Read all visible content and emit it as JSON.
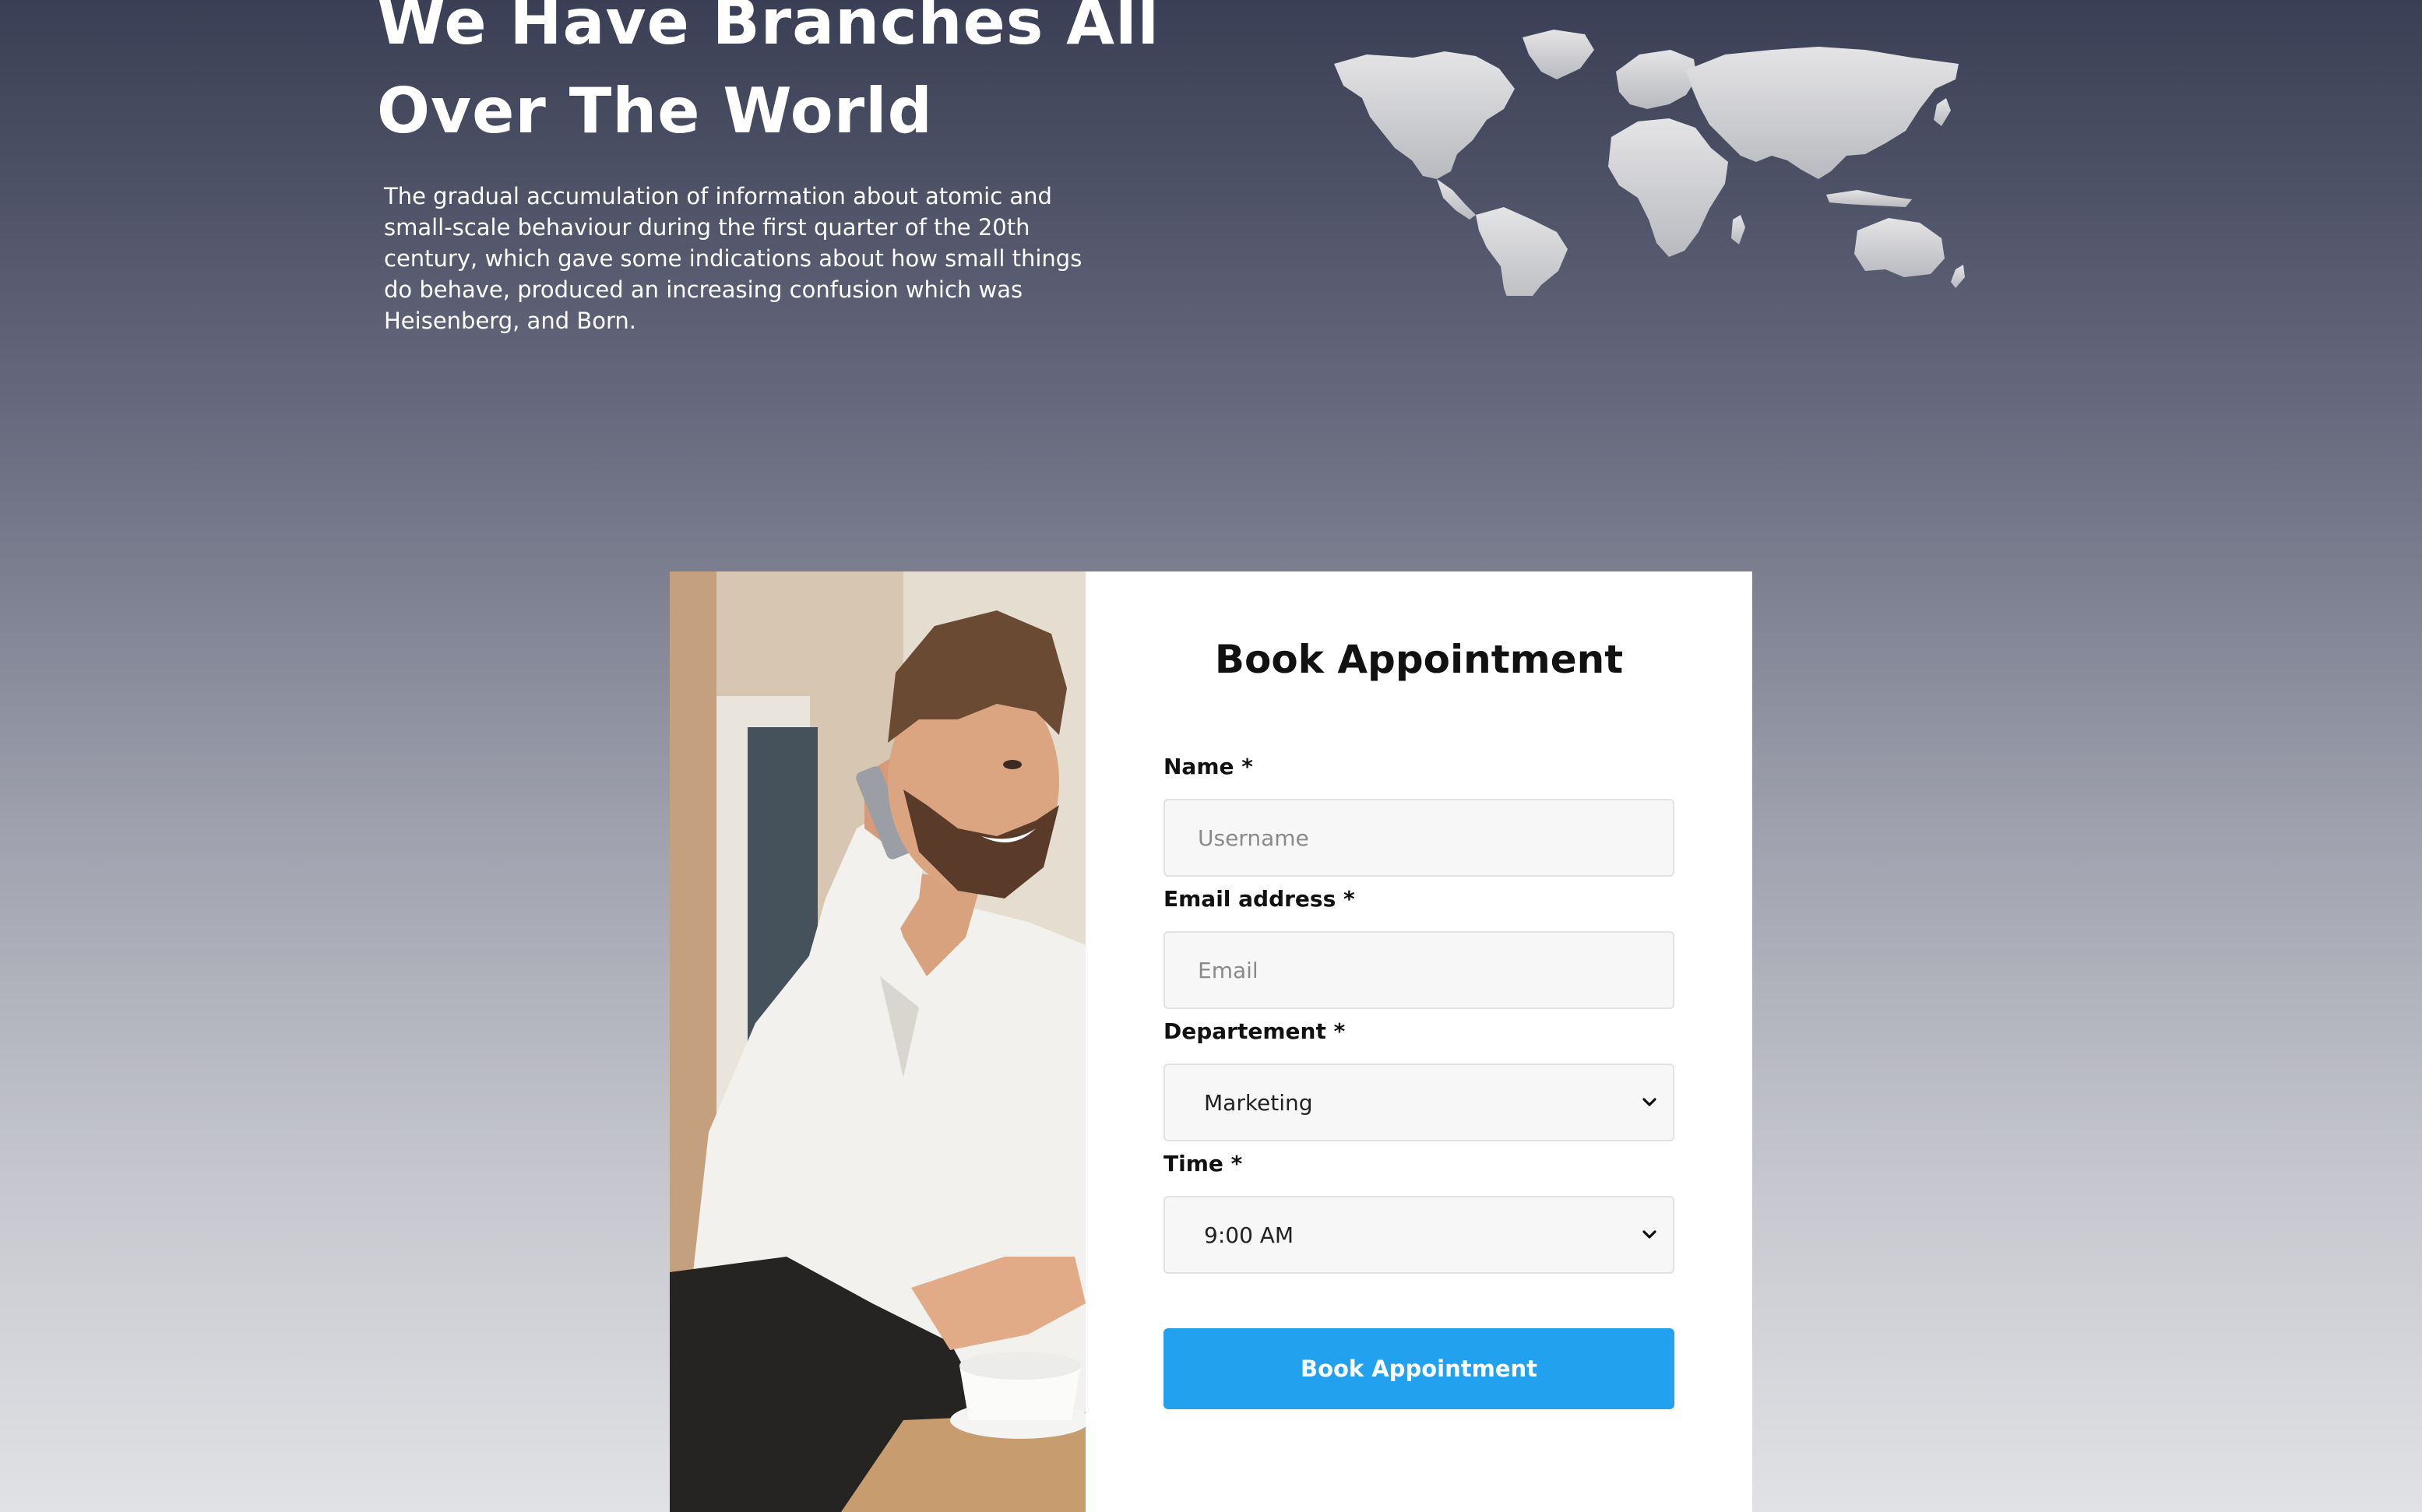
{
  "hero": {
    "title_line1": "We Have Branches All",
    "title_line2": "Over The World",
    "description": "The gradual accumulation of information about atomic and small-scale behaviour during the first quarter of the 20th century, which gave some indications about how small things do behave, produced an increasing confusion which was Heisenberg, and Born.",
    "map_icon": "world-map",
    "map_color": "#d7d7d9"
  },
  "booking": {
    "title": "Book Appointment",
    "name_label": "Name *",
    "name_placeholder": "Username",
    "email_label": "Email address *",
    "email_placeholder": "Email",
    "department_label": "Departement *",
    "department_value": "Marketing",
    "time_label": "Time *",
    "time_value": "9:00 AM",
    "submit_label": "Book Appointment",
    "button_color": "#22a2ee"
  }
}
